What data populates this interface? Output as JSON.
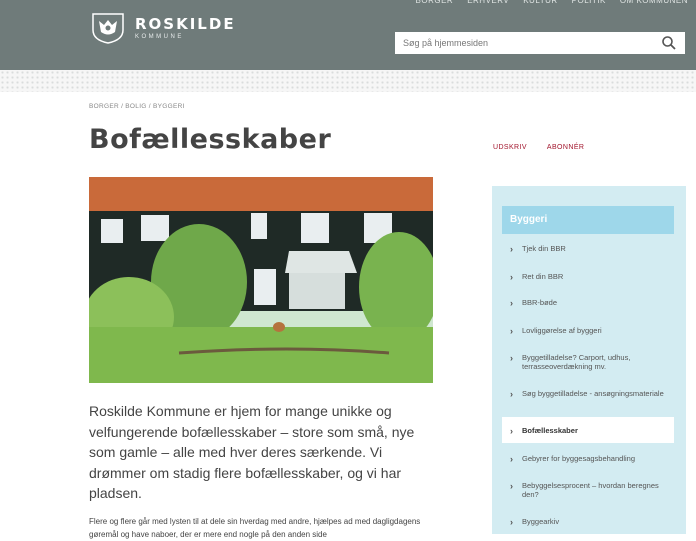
{
  "header": {
    "brand_name": "ROSKILDE",
    "brand_sub": "KOMMUNE",
    "top_nav": [
      "BORGER",
      "ERHVERV",
      "KULTUR",
      "POLITIK",
      "OM KOMMUNEN"
    ],
    "search_placeholder": "Søg på hjemmesiden"
  },
  "breadcrumb": "BORGER / BOLIG / BYGGERI",
  "page": {
    "title": "Bofællesskaber",
    "actions": [
      "UDSKRIV",
      "ABONNÉR"
    ],
    "intro": "Roskilde Kommune er hjem for mange unikke og velfungerende bofællesskaber – store som små, nye som gamle – alle med hver deres særkende. Vi drømmer om stadig flere bofællesskaber, og vi har pladsen.",
    "body": "Flere og flere går med lysten til at dele sin hverdag med andre, hjælpes ad med dagligdagens gøremål og have naboer, der er mere end nogle på den anden side"
  },
  "sidebar": {
    "heading": "Byggeri",
    "items": [
      {
        "label": "Tjek din BBR"
      },
      {
        "label": "Ret din BBR"
      },
      {
        "label": "BBR-bøde"
      },
      {
        "label": "Lovliggørelse af byggeri"
      },
      {
        "label": "Byggetilladelse? Carport, udhus, terrasseoverdækning mv."
      },
      {
        "label": "Søg byggetilladelse - ansøgningsmateriale"
      },
      {
        "label": "Bofællesskaber"
      },
      {
        "label": "Gebyrer for byggesagsbehandling"
      },
      {
        "label": "Bebyggelsesprocent – hvordan beregnes den?"
      },
      {
        "label": "Byggearkiv"
      }
    ],
    "active_index": 6
  },
  "colors": {
    "topbar": "#6f7b7a",
    "accent": "#a2152c",
    "sidebar": "#d3ecf2",
    "sidebar_head": "#9ed7ea"
  }
}
